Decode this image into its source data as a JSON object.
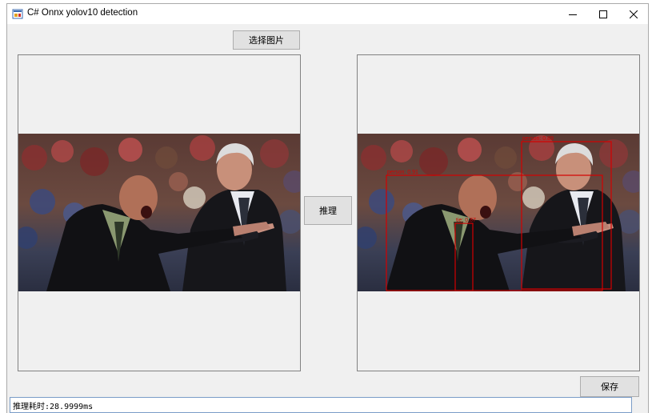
{
  "window": {
    "title": "C# Onnx yolov10 detection",
    "icon": "app-icon",
    "controls": [
      "minimize-icon",
      "maximize-icon",
      "close-icon"
    ]
  },
  "buttons": {
    "select_image": "选择图片",
    "infer": "推理",
    "save": "保存"
  },
  "status": {
    "text": "推理耗时:28.9999ms"
  },
  "detections": {
    "color": "#d40000",
    "labels": [
      "person: 0.89",
      "person: 0.91",
      "tie: 0.87"
    ]
  }
}
